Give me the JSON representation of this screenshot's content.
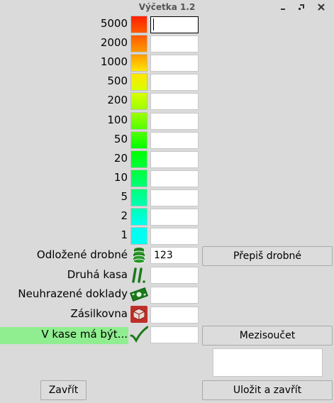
{
  "window": {
    "title": "Výčetka 1.2"
  },
  "denominations": [
    {
      "label": "5000",
      "value": "",
      "color": "#ff2000"
    },
    {
      "label": "2000",
      "value": "",
      "color": "#ff5a00"
    },
    {
      "label": "1000",
      "value": "",
      "color": "#ff9a00"
    },
    {
      "label": "500",
      "value": "",
      "color": "#ffe600"
    },
    {
      "label": "200",
      "value": "",
      "color": "#d8ff00"
    },
    {
      "label": "100",
      "value": "",
      "color": "#9cff00"
    },
    {
      "label": "50",
      "value": "",
      "color": "#52ff00"
    },
    {
      "label": "20",
      "value": "",
      "color": "#00ff00"
    },
    {
      "label": "10",
      "value": "",
      "color": "#00ff3c"
    },
    {
      "label": "5",
      "value": "",
      "color": "#00ff7a"
    },
    {
      "label": "2",
      "value": "",
      "color": "#00ffb4"
    },
    {
      "label": "1",
      "value": "",
      "color": "#00fff0"
    }
  ],
  "extras": {
    "odlozene": {
      "label": "Odložené drobné",
      "value": "123",
      "icon": "coins-icon"
    },
    "druha_kasa": {
      "label": "Druhá kasa",
      "value": "",
      "icon": "roman-two-icon"
    },
    "neuhrazene": {
      "label": "Neuhrazené doklady",
      "value": "",
      "icon": "money-bill-icon"
    },
    "zasilkovna": {
      "label": "Zásilkovna",
      "value": "",
      "icon": "package-icon"
    },
    "v_kase": {
      "label": "V kase má být...",
      "value": "",
      "icon": "checkmark-icon"
    }
  },
  "buttons": {
    "prepis_drobne": "Přepiš drobné",
    "mezisoucet": "Mezisoučet",
    "zavrit": "Zavřít",
    "ulozit_a_zavrit": "Uložit a zavřít"
  },
  "note": {
    "value": ""
  },
  "colors": {
    "highlight": "#90ee90",
    "icon_green": "#1a7a1a",
    "package_red": "#c0302a"
  }
}
